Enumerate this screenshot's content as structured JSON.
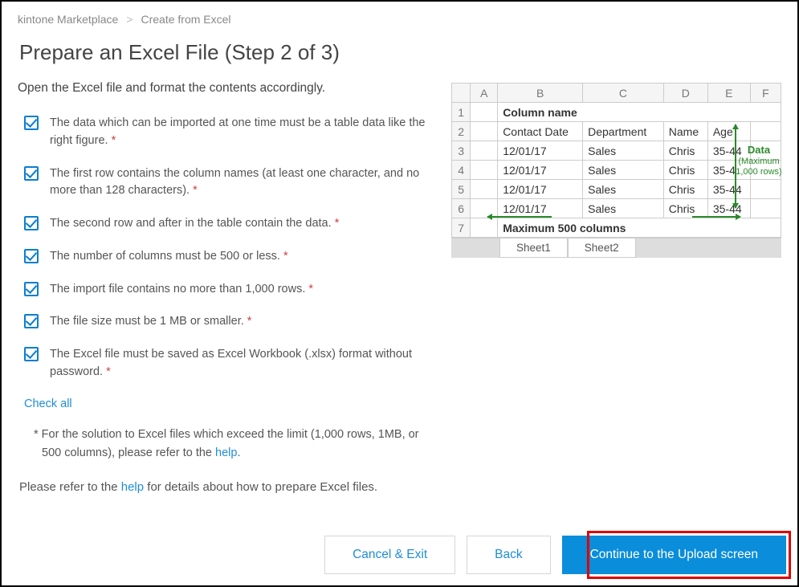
{
  "breadcrumb": {
    "item1": "kintone Marketplace",
    "sep": ">",
    "item2": "Create from Excel"
  },
  "page_title": "Prepare an Excel File (Step 2 of 3)",
  "instruction_heading": "Open the Excel file and format the contents accordingly.",
  "requirements": [
    "The data which can be imported at one time must be a table data like the right figure.",
    "The first row contains the column names (at least one character, and no more than 128 characters).",
    "The second row and after in the table contain the data.",
    "The number of columns must be 500 or less.",
    "The import file contains no more than 1,000 rows.",
    "The file size must be 1 MB or smaller.",
    "The Excel file must be saved as Excel Workbook (.xlsx) format without password."
  ],
  "asterisk": "*",
  "check_all_label": "Check all",
  "note_prefix": "* For the solution to Excel files which exceed the limit (1,000 rows, 1MB, or 500 columns), please refer to the ",
  "note_link": "help",
  "note_suffix": ".",
  "final_prefix": "Please refer to the ",
  "final_link": "help",
  "final_suffix": " for details about how to prepare Excel files.",
  "excel": {
    "cols": [
      "A",
      "B",
      "C",
      "D",
      "E",
      "F"
    ],
    "annot_column_name": "Column name",
    "headers": {
      "B": "Contact Date",
      "C": "Department",
      "D": "Name",
      "E": "Age"
    },
    "rows": [
      {
        "B": "12/01/17",
        "C": "Sales",
        "D": "Chris",
        "E": "35-44"
      },
      {
        "B": "12/01/17",
        "C": "Sales",
        "D": "Chris",
        "E": "35-4"
      },
      {
        "B": "12/01/17",
        "C": "Sales",
        "D": "Chris",
        "E": "35-44"
      },
      {
        "B": "12/01/17",
        "C": "Sales",
        "D": "Chris",
        "E": "35-44"
      }
    ],
    "annot_max_cols": "Maximum 500 columns",
    "annot_data": "Data",
    "annot_data_sub": "(Maximum 1,000 rows)",
    "sheet1": "Sheet1",
    "sheet2": "Sheet2"
  },
  "buttons": {
    "cancel": "Cancel & Exit",
    "back": "Back",
    "continue": "Continue to the Upload screen"
  }
}
